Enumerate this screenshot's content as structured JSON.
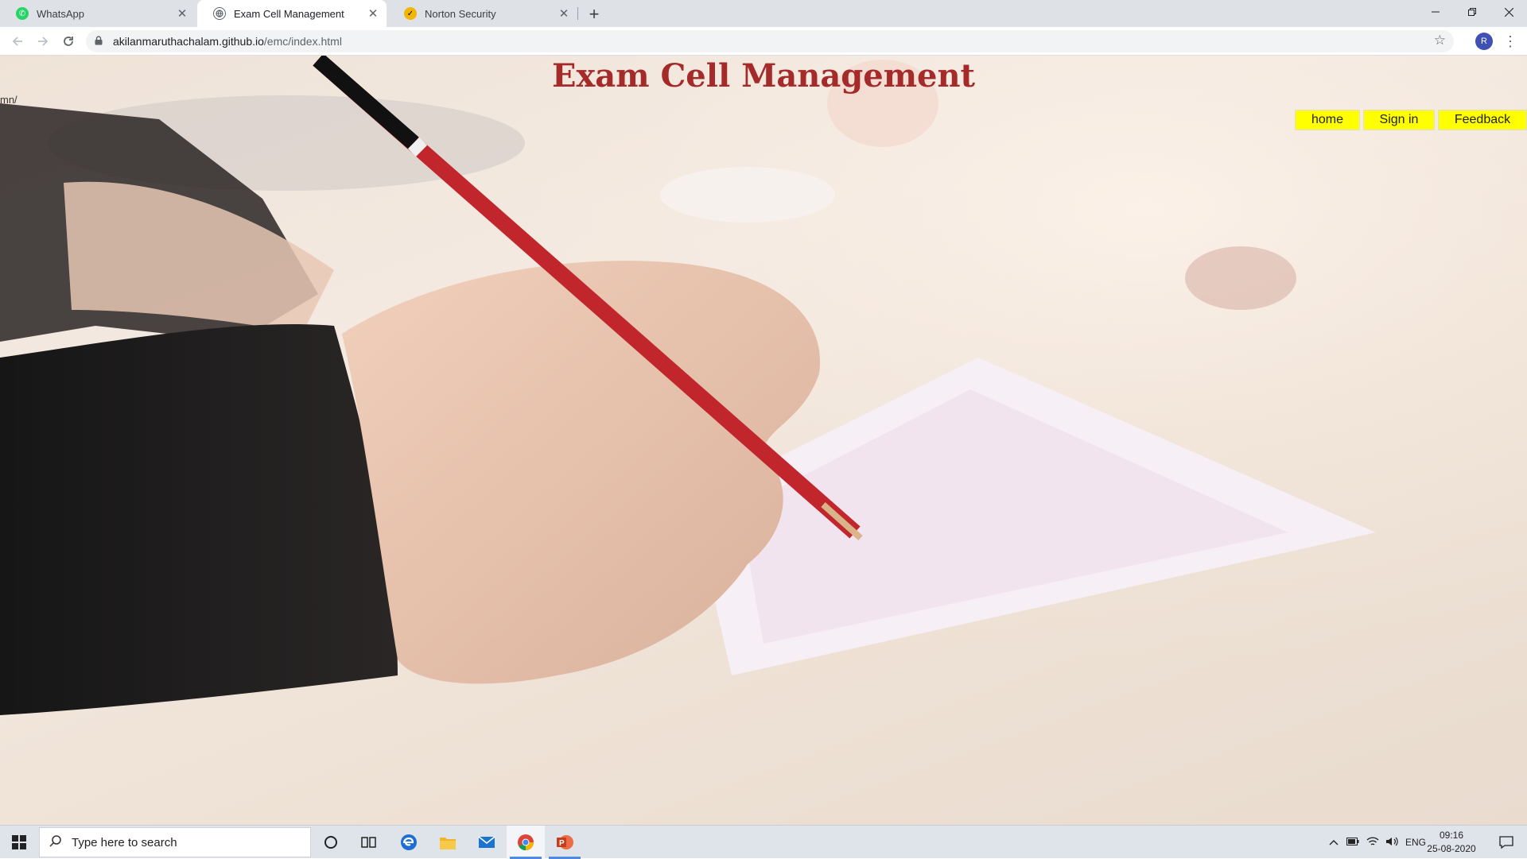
{
  "browser": {
    "tabs": [
      {
        "title": "WhatsApp",
        "icon": "whatsapp-icon",
        "icon_color": "#25d366",
        "active": false
      },
      {
        "title": "Exam Cell Management",
        "icon": "globe-icon",
        "icon_color": "#5f6368",
        "active": true
      },
      {
        "title": "Norton Security",
        "icon": "norton-check-icon",
        "icon_color": "#f2b705",
        "active": false
      }
    ],
    "address": {
      "host": "akilanmaruthachalam.github.io",
      "path": "/emc/index.html"
    },
    "profile_initial": "R"
  },
  "page": {
    "title": "Exam Cell Management",
    "title_color": "#a52a2a",
    "stray_text": "mn/",
    "nav": [
      {
        "label": "home"
      },
      {
        "label": "Sign in"
      },
      {
        "label": "Feedback"
      }
    ],
    "nav_color": "#ffff00"
  },
  "taskbar": {
    "search_placeholder": "Type here to search",
    "language": "ENG",
    "time": "09:16",
    "date": "25-08-2020",
    "apps": [
      "cortana-icon",
      "task-view-icon",
      "edge-icon",
      "file-explorer-icon",
      "mail-icon",
      "chrome-icon",
      "powerpoint-icon"
    ]
  }
}
